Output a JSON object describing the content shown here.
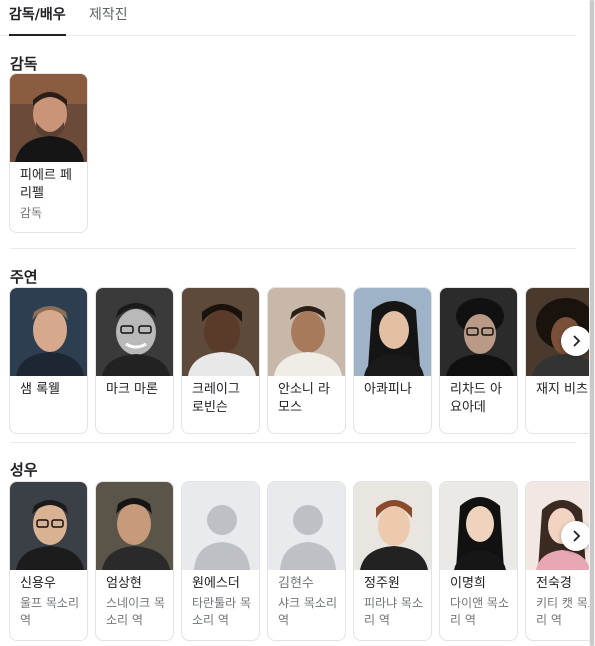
{
  "tabs": {
    "cast_label": "감독/배우",
    "crew_label": "제작진"
  },
  "sections": {
    "director_title": "감독",
    "lead_title": "주연",
    "voice_title": "성우"
  },
  "director": [
    {
      "name": "피에르 페리펠",
      "role": "감독"
    }
  ],
  "lead_cast": [
    {
      "name": "샘 록웰"
    },
    {
      "name": "마크 마론"
    },
    {
      "name": "크레이그 로빈슨"
    },
    {
      "name": "안소니 라모스"
    },
    {
      "name": "아콰피나"
    },
    {
      "name": "리차드 아요아데"
    },
    {
      "name": "재지 비츠"
    }
  ],
  "voice_cast": [
    {
      "name": "신용우",
      "role": "울프 목소리 역"
    },
    {
      "name": "엄상현",
      "role": "스네이크 목소리 역"
    },
    {
      "name": "원에스더",
      "role": "타란툴라 목소리 역"
    },
    {
      "name": "김현수",
      "role": "샤크 목소리 역"
    },
    {
      "name": "정주원",
      "role": "피라냐 목소리 역"
    },
    {
      "name": "이명희",
      "role": "다이앤 목소리 역"
    },
    {
      "name": "전숙경",
      "role": "키티 캣 목소리 역"
    }
  ]
}
